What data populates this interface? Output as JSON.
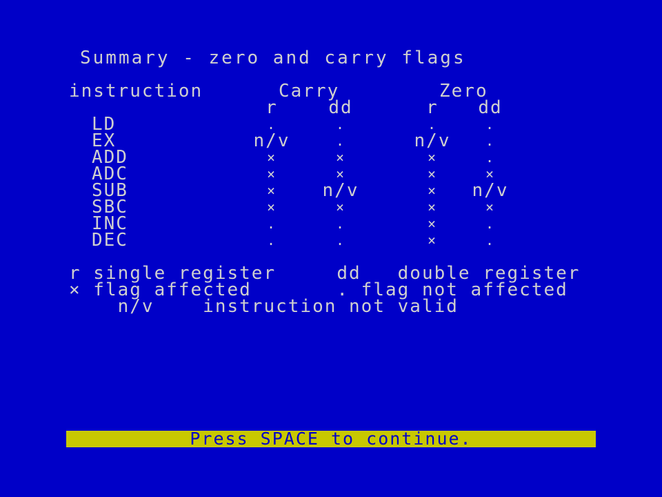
{
  "screen": {
    "title": "Summary - zero and carry flags",
    "header": {
      "instruction": "instruction",
      "carry": "Carry",
      "zero": "Zero",
      "carry_r": "r",
      "carry_dd": "dd",
      "zero_r": "r",
      "zero_dd": "dd"
    },
    "rows": [
      {
        "instr": "LD",
        "carry_r": ".",
        "carry_dd": ".",
        "zero_r": ".",
        "zero_dd": "."
      },
      {
        "instr": "EX",
        "carry_r": "n/v",
        "carry_dd": ".",
        "zero_r": "n/v",
        "zero_dd": "."
      },
      {
        "instr": "ADD",
        "carry_r": "×",
        "carry_dd": "×",
        "zero_r": "×",
        "zero_dd": "."
      },
      {
        "instr": "ADC",
        "carry_r": "×",
        "carry_dd": "×",
        "zero_r": "×",
        "zero_dd": "×"
      },
      {
        "instr": "SUB",
        "carry_r": "×",
        "carry_dd": "n/v",
        "zero_r": "×",
        "zero_dd": "n/v"
      },
      {
        "instr": "SBC",
        "carry_r": "×",
        "carry_dd": "×",
        "zero_r": "×",
        "zero_dd": "×"
      },
      {
        "instr": "INC",
        "carry_r": ".",
        "carry_dd": ".",
        "zero_r": "×",
        "zero_dd": "."
      },
      {
        "instr": "DEC",
        "carry_r": ".",
        "carry_dd": ".",
        "zero_r": "×",
        "zero_dd": "."
      }
    ],
    "legend": {
      "line1": "r single register     dd   double register",
      "line2": "× flag affected       . flag not affected",
      "line3": "    n/v    instruction not valid"
    },
    "footer": "Press SPACE to continue."
  },
  "colors": {
    "background": "#0000c8",
    "text": "#cfcfcf",
    "footer_bar": "#c8c800",
    "footer_text": "#0000c8"
  }
}
